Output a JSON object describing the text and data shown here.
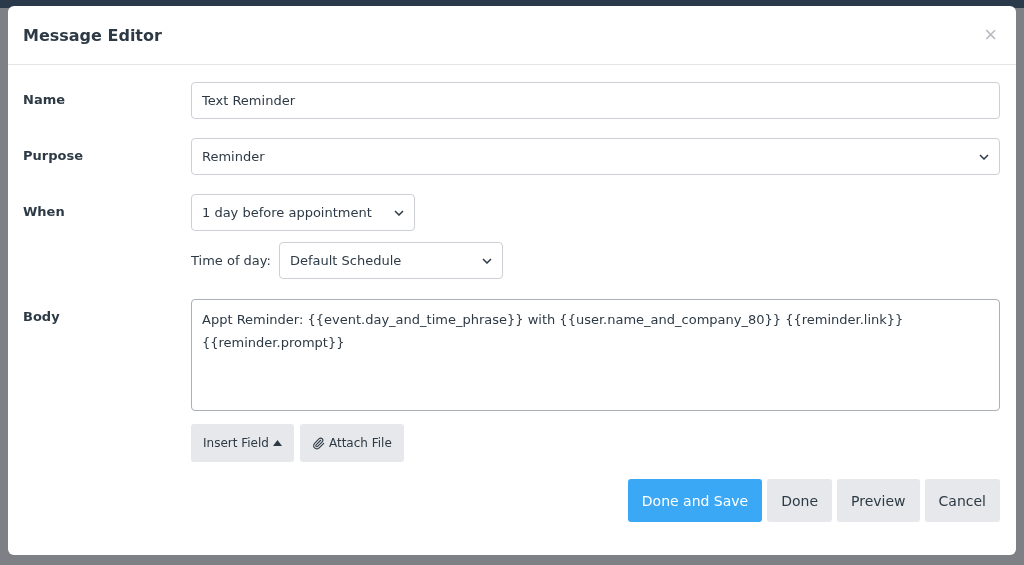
{
  "dialog": {
    "title": "Message Editor",
    "close": "×"
  },
  "fields": [
    {
      "kind": "text",
      "label": "Name",
      "value": "Text Reminder"
    },
    {
      "kind": "select",
      "label": "Purpose",
      "value": "Reminder"
    },
    {
      "kind": "when",
      "label": "When",
      "value": "1 day before appointment",
      "sublabel": "Time of day:",
      "subvalue": "Default Schedule"
    },
    {
      "kind": "textarea",
      "label": "Body",
      "value": "Appt Reminder: {{event.day_and_time_phrase}} with {{user.name_and_company_80}} {{reminder.link}} {{reminder.prompt}}"
    }
  ],
  "tools": [
    {
      "kind": "insert",
      "label": "Insert Field"
    },
    {
      "kind": "attach",
      "label": "Attach File"
    }
  ],
  "buttons": [
    {
      "label": "Done and Save",
      "primary": true
    },
    {
      "label": "Done",
      "primary": false
    },
    {
      "label": "Preview",
      "primary": false
    },
    {
      "label": "Cancel",
      "primary": false
    }
  ]
}
